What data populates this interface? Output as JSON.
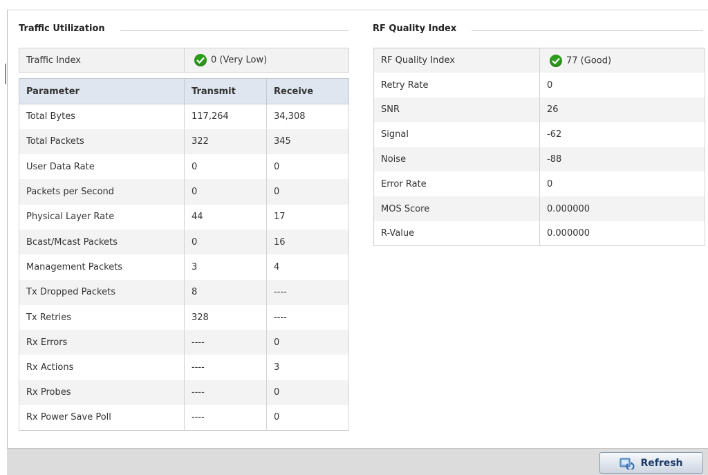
{
  "traffic": {
    "title": "Traffic Utilization",
    "index_label": "Traffic Index",
    "index_value": "0 (Very Low)",
    "headers": {
      "parameter": "Parameter",
      "transmit": "Transmit",
      "receive": "Receive"
    },
    "rows": [
      {
        "parameter": "Total Bytes",
        "transmit": "117,264",
        "receive": "34,308"
      },
      {
        "parameter": "Total Packets",
        "transmit": "322",
        "receive": "345"
      },
      {
        "parameter": "User Data Rate",
        "transmit": "0",
        "receive": "0"
      },
      {
        "parameter": "Packets per Second",
        "transmit": "0",
        "receive": "0"
      },
      {
        "parameter": "Physical Layer Rate",
        "transmit": "44",
        "receive": "17"
      },
      {
        "parameter": "Bcast/Mcast Packets",
        "transmit": "0",
        "receive": "16"
      },
      {
        "parameter": "Management Packets",
        "transmit": "3",
        "receive": "4"
      },
      {
        "parameter": "Tx Dropped Packets",
        "transmit": "8",
        "receive": "----"
      },
      {
        "parameter": "Tx Retries",
        "transmit": "328",
        "receive": "----"
      },
      {
        "parameter": "Rx Errors",
        "transmit": "----",
        "receive": "0"
      },
      {
        "parameter": "Rx Actions",
        "transmit": "----",
        "receive": "3"
      },
      {
        "parameter": "Rx Probes",
        "transmit": "----",
        "receive": "0"
      },
      {
        "parameter": "Rx Power Save Poll",
        "transmit": "----",
        "receive": "0"
      }
    ]
  },
  "rf": {
    "title": "RF Quality Index",
    "rows": [
      {
        "label": "RF Quality Index",
        "value": "77 (Good)",
        "status_icon": "check-circle"
      },
      {
        "label": "Retry Rate",
        "value": "0"
      },
      {
        "label": "SNR",
        "value": "26"
      },
      {
        "label": "Signal",
        "value": "-62"
      },
      {
        "label": "Noise",
        "value": "-88"
      },
      {
        "label": "Error Rate",
        "value": "0"
      },
      {
        "label": "MOS Score",
        "value": "0.000000"
      },
      {
        "label": "R-Value",
        "value": "0.000000"
      }
    ]
  },
  "footer": {
    "refresh_label": "Refresh"
  },
  "colors": {
    "status_good": "#2f9b1e",
    "header_bg": "#dfe6ef",
    "footer_bg": "#dcdcdc"
  }
}
